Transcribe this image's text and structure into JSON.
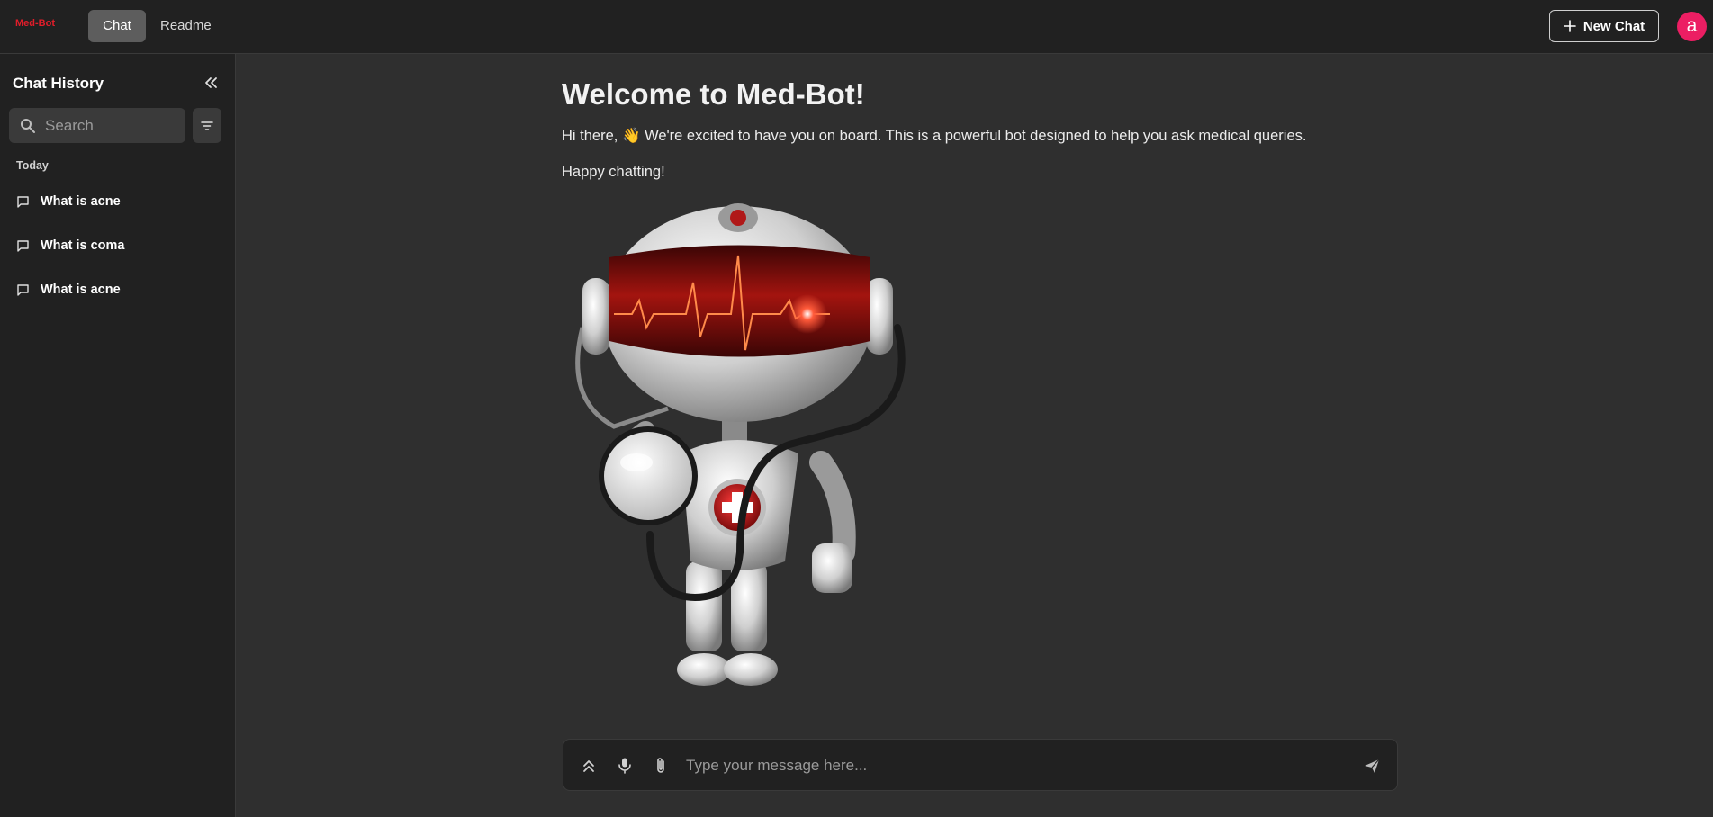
{
  "header": {
    "logo": "Med-Bot",
    "tabs": [
      {
        "label": "Chat",
        "active": true
      },
      {
        "label": "Readme",
        "active": false
      }
    ],
    "new_chat_label": "New Chat",
    "avatar_letter": "a"
  },
  "sidebar": {
    "title": "Chat History",
    "search_placeholder": "Search",
    "group_label": "Today",
    "items": [
      {
        "label": "What is acne"
      },
      {
        "label": "What is coma"
      },
      {
        "label": "What is acne"
      }
    ]
  },
  "main": {
    "heading": "Welcome to Med-Bot!",
    "intro": "Hi there, 👋 We're excited to have you on board. This is a powerful bot designed to help you ask medical queries.",
    "closing": "Happy chatting!"
  },
  "composer": {
    "placeholder": "Type your message here..."
  },
  "colors": {
    "accent_red": "#e11d2a",
    "avatar": "#ec1e63",
    "background": "#2f2f2f",
    "panel": "#212121"
  }
}
